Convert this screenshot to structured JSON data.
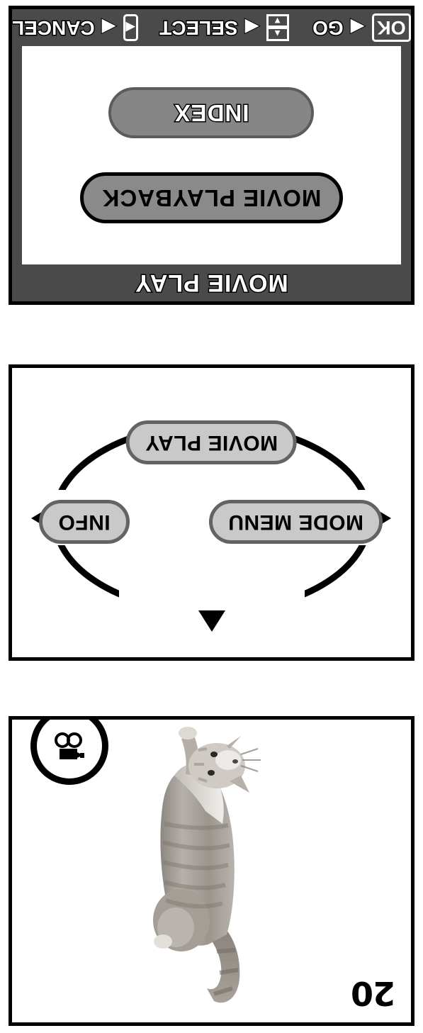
{
  "page": {
    "orientation": "rotated-180",
    "panel_count": 3
  },
  "panel_menu": {
    "name": "movie-play-menu-screen",
    "title": "MOVIE PLAY",
    "items": [
      {
        "label": "MOVIE PLAYBACK",
        "selected": false
      },
      {
        "label": "INDEX",
        "selected": true
      }
    ],
    "guide_bar": {
      "ok_key_label": "OK",
      "go_label": "GO",
      "go_arrow": "◀",
      "select_label": "SELECT",
      "select_arrow": "◀",
      "select_key_icon": "updown-arrows-icon",
      "cancel_label": "CANCEL",
      "cancel_arrow": "◀",
      "cancel_key_icon": "left-arrow-key-icon",
      "up_glyph": "▲",
      "down_glyph": "▼",
      "left_glyph": "◀"
    },
    "colors": {
      "chrome": "#4a4a4a",
      "screen": "#ffffff",
      "selected_fill": "#868686",
      "unselected_fill": "#8a8a8a"
    }
  },
  "panel_cycle": {
    "name": "mode-cycle-diagram",
    "buttons": [
      {
        "label": "MODE MENU",
        "position": "left"
      },
      {
        "label": "INFO",
        "position": "right"
      },
      {
        "label": "MOVIE PLAY",
        "position": "top"
      }
    ],
    "arrows": {
      "left_glyph": "◀",
      "right_glyph": "▶",
      "up_glyph": "▲"
    },
    "colors": {
      "button_fill": "#c9c9c9",
      "button_border": "#636363",
      "ellipse_stroke": "#000000"
    }
  },
  "panel_frame": {
    "name": "movie-playback-frame",
    "frame_number": "20",
    "movie_icon": "movie-camera-icon",
    "photo_subject": "cat",
    "colors": {
      "background": "#ffffff",
      "badge_stroke": "#000000"
    }
  }
}
